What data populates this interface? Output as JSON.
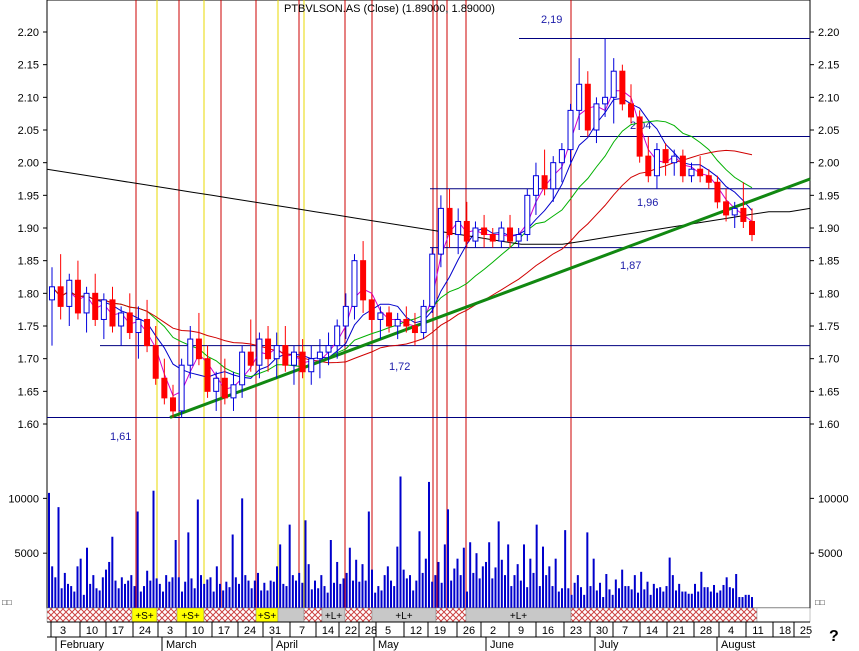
{
  "title": "PTBVLSON.AS (Close) (1.89000, 1.89000)",
  "help_label": "?",
  "colors": {
    "up_candle": "#ffffff",
    "down_candle": "#ff0000",
    "up_candle_blue": "#0000dd",
    "ma_magenta": "#d000d0",
    "ma_blue": "#0000cc",
    "ma_green": "#00b000",
    "ma_red": "#d00000",
    "ma_black": "#000000",
    "trendline": "#118811",
    "support": "#000080",
    "vline_red": "#cc0000",
    "vline_yellow": "#e8d800",
    "volume": "#0000cc",
    "strip_red": "#cc4444",
    "strip_gray": "#c8c8c8",
    "strip_yellow": "#ffff00"
  },
  "chart_data": {
    "type": "candlestick",
    "ylim": [
      1.6,
      2.2
    ],
    "yticks": [
      "2.20",
      "2.15",
      "2.10",
      "2.05",
      "2.00",
      "1.95",
      "1.90",
      "1.85",
      "1.80",
      "1.75",
      "1.70",
      "1.65",
      "1.60"
    ],
    "volume_ticks": [
      "10000",
      "5000"
    ],
    "volume_ylim": [
      0,
      13500
    ],
    "months": [
      "February",
      "March",
      "April",
      "May",
      "June",
      "July",
      "August"
    ],
    "day_ticks": [
      "3",
      "10",
      "17",
      "24",
      "3",
      "10",
      "17",
      "24",
      "31",
      "7",
      "14",
      "22",
      "28",
      "5",
      "12",
      "19",
      "26",
      "2",
      "9",
      "16",
      "23",
      "30",
      "7",
      "14",
      "21",
      "28",
      "4",
      "11",
      "18",
      "25"
    ],
    "levels": [
      {
        "value": 1.61,
        "label": "1,61"
      },
      {
        "value": 1.72,
        "label": "1,72"
      },
      {
        "value": 1.87,
        "label": "1,87"
      },
      {
        "value": 1.96,
        "label": "1,96"
      },
      {
        "value": 2.04,
        "label": "2,04"
      },
      {
        "value": 2.19,
        "label": "2,19"
      }
    ],
    "trendline": {
      "start": 1.61,
      "end": 1.975
    },
    "ma_long": [
      1.99,
      1.985,
      1.98,
      1.975,
      1.97,
      1.965,
      1.96,
      1.955,
      1.95,
      1.945,
      1.94,
      1.935,
      1.93,
      1.925,
      1.92,
      1.915,
      1.91,
      1.905,
      1.9,
      1.895,
      1.89,
      1.885,
      1.88,
      1.875,
      1.875,
      1.875,
      1.88,
      1.885,
      1.89,
      1.895,
      1.9,
      1.905,
      1.91,
      1.915,
      1.92,
      1.925,
      1.925,
      1.93
    ],
    "volumes": [
      10500,
      3800,
      2800,
      9200,
      1800,
      3200,
      2200,
      2000,
      1500,
      3800,
      4500,
      1200,
      5500,
      2200,
      3000,
      1800,
      1600,
      2800,
      3500,
      4200,
      6500,
      2500,
      1800,
      2800,
      2200,
      2500,
      3000,
      2000,
      8800,
      1500,
      2000,
      3400,
      2500,
      10700,
      2700,
      2200,
      1500,
      3000,
      2400,
      2800,
      6200,
      2800,
      1500,
      2400,
      6900,
      2700,
      1800,
      9900,
      3000,
      2200,
      2600,
      2800,
      1500,
      3800,
      2200,
      1600,
      2400,
      1900,
      6700,
      2800,
      2200,
      10000,
      3000,
      2500,
      1800,
      2500,
      3200,
      1600,
      2300,
      1600,
      2500,
      2400,
      3800,
      5800,
      2200,
      2000,
      7600,
      3000,
      2500,
      3200,
      2300,
      8000,
      4000,
      1700,
      2500,
      1800,
      3000,
      2000,
      1400,
      6200,
      2300,
      4200,
      2200,
      2700,
      3200,
      5500,
      2500,
      4400,
      2400,
      4000,
      2500,
      8800,
      3500,
      1400,
      2000,
      1600,
      3000,
      3800,
      2500,
      2000,
      5600,
      12000,
      3500,
      2700,
      3000,
      1600,
      2500,
      7000,
      3200,
      4500,
      11500,
      2400,
      3000,
      4200,
      2300,
      5800,
      9000,
      2500,
      3600,
      4500,
      3000,
      5500,
      1500,
      6000,
      3200,
      5000,
      2700,
      3800,
      4200,
      6000,
      2700,
      3700,
      7900,
      4400,
      3000,
      5800,
      2000,
      3000,
      4000,
      2500,
      5800,
      1900,
      4500,
      3200,
      7600,
      2000,
      5600,
      3000,
      3800,
      2000,
      4500,
      1500,
      1800,
      7100,
      1800,
      1200,
      2300,
      3000,
      1900,
      1200,
      6900,
      2000,
      4500,
      1600,
      2300,
      1000,
      3100,
      1700,
      1200,
      2600,
      1800,
      3500,
      2000,
      2000,
      1700,
      3000,
      1400,
      3300,
      1700,
      2400,
      1200,
      2200,
      1800,
      1900,
      1500,
      2000,
      4600,
      3000,
      1600,
      2200,
      1500,
      1500,
      1300,
      1300,
      2200,
      1500,
      3300,
      1900,
      1900,
      1500,
      2100,
      1400,
      1600,
      2100,
      2800,
      1900,
      1800,
      3100,
      1000,
      1000,
      1200,
      1200,
      1000
    ],
    "candles": [
      [
        1.79,
        1.84,
        1.72,
        1.81
      ],
      [
        1.81,
        1.86,
        1.76,
        1.78
      ],
      [
        1.78,
        1.83,
        1.75,
        1.82
      ],
      [
        1.82,
        1.85,
        1.76,
        1.77
      ],
      [
        1.77,
        1.81,
        1.74,
        1.8
      ],
      [
        1.8,
        1.83,
        1.75,
        1.76
      ],
      [
        1.76,
        1.8,
        1.73,
        1.79
      ],
      [
        1.79,
        1.81,
        1.74,
        1.75
      ],
      [
        1.75,
        1.78,
        1.72,
        1.77
      ],
      [
        1.77,
        1.8,
        1.73,
        1.74
      ],
      [
        1.74,
        1.78,
        1.7,
        1.76
      ],
      [
        1.76,
        1.79,
        1.71,
        1.72
      ],
      [
        1.72,
        1.75,
        1.66,
        1.67
      ],
      [
        1.67,
        1.7,
        1.63,
        1.64
      ],
      [
        1.64,
        1.66,
        1.61,
        1.62
      ],
      [
        1.62,
        1.7,
        1.61,
        1.69
      ],
      [
        1.69,
        1.75,
        1.67,
        1.73
      ],
      [
        1.73,
        1.77,
        1.69,
        1.7
      ],
      [
        1.7,
        1.72,
        1.64,
        1.65
      ],
      [
        1.65,
        1.68,
        1.62,
        1.67
      ],
      [
        1.67,
        1.7,
        1.63,
        1.64
      ],
      [
        1.64,
        1.68,
        1.62,
        1.66
      ],
      [
        1.66,
        1.72,
        1.64,
        1.71
      ],
      [
        1.71,
        1.76,
        1.68,
        1.69
      ],
      [
        1.69,
        1.74,
        1.67,
        1.73
      ],
      [
        1.73,
        1.75,
        1.68,
        1.7
      ],
      [
        1.7,
        1.74,
        1.67,
        1.72
      ],
      [
        1.72,
        1.75,
        1.68,
        1.69
      ],
      [
        1.69,
        1.72,
        1.66,
        1.71
      ],
      [
        1.71,
        1.73,
        1.67,
        1.68
      ],
      [
        1.68,
        1.72,
        1.66,
        1.7
      ],
      [
        1.7,
        1.73,
        1.67,
        1.71
      ],
      [
        1.71,
        1.74,
        1.69,
        1.72
      ],
      [
        1.72,
        1.76,
        1.7,
        1.75
      ],
      [
        1.75,
        1.8,
        1.73,
        1.78
      ],
      [
        1.78,
        1.86,
        1.76,
        1.85
      ],
      [
        1.85,
        1.88,
        1.77,
        1.79
      ],
      [
        1.79,
        1.8,
        1.74,
        1.76
      ],
      [
        1.76,
        1.78,
        1.73,
        1.77
      ],
      [
        1.77,
        1.78,
        1.74,
        1.75
      ],
      [
        1.75,
        1.77,
        1.73,
        1.76
      ],
      [
        1.76,
        1.78,
        1.74,
        1.75
      ],
      [
        1.75,
        1.77,
        1.72,
        1.74
      ],
      [
        1.74,
        1.79,
        1.73,
        1.78
      ],
      [
        1.78,
        1.87,
        1.77,
        1.86
      ],
      [
        1.86,
        1.95,
        1.84,
        1.93
      ],
      [
        1.93,
        1.96,
        1.87,
        1.89
      ],
      [
        1.89,
        1.93,
        1.86,
        1.91
      ],
      [
        1.91,
        1.94,
        1.87,
        1.88
      ],
      [
        1.88,
        1.91,
        1.87,
        1.9
      ],
      [
        1.9,
        1.92,
        1.87,
        1.89
      ],
      [
        1.89,
        1.9,
        1.87,
        1.88
      ],
      [
        1.88,
        1.91,
        1.87,
        1.9
      ],
      [
        1.9,
        1.92,
        1.87,
        1.88
      ],
      [
        1.88,
        1.9,
        1.87,
        1.89
      ],
      [
        1.89,
        1.96,
        1.88,
        1.95
      ],
      [
        1.95,
        2.0,
        1.92,
        1.98
      ],
      [
        1.98,
        2.02,
        1.95,
        1.96
      ],
      [
        1.96,
        2.01,
        1.94,
        2.0
      ],
      [
        2.0,
        2.03,
        1.97,
        2.02
      ],
      [
        2.02,
        2.09,
        2.0,
        2.08
      ],
      [
        2.08,
        2.16,
        2.05,
        2.12
      ],
      [
        2.12,
        2.14,
        2.04,
        2.05
      ],
      [
        2.05,
        2.1,
        2.03,
        2.09
      ],
      [
        2.09,
        2.19,
        2.07,
        2.1
      ],
      [
        2.1,
        2.16,
        2.06,
        2.14
      ],
      [
        2.14,
        2.15,
        2.08,
        2.09
      ],
      [
        2.09,
        2.12,
        2.06,
        2.07
      ],
      [
        2.07,
        2.08,
        2.0,
        2.01
      ],
      [
        2.01,
        2.04,
        1.97,
        1.98
      ],
      [
        1.98,
        2.03,
        1.96,
        2.02
      ],
      [
        2.02,
        2.03,
        1.98,
        2.0
      ],
      [
        2.0,
        2.02,
        1.98,
        2.01
      ],
      [
        2.01,
        2.02,
        1.97,
        1.98
      ],
      [
        1.98,
        2.0,
        1.97,
        1.99
      ],
      [
        1.99,
        2.01,
        1.97,
        1.98
      ],
      [
        1.98,
        1.99,
        1.96,
        1.97
      ],
      [
        1.97,
        1.98,
        1.93,
        1.94
      ],
      [
        1.94,
        1.96,
        1.91,
        1.92
      ],
      [
        1.92,
        1.94,
        1.9,
        1.93
      ],
      [
        1.93,
        1.97,
        1.9,
        1.91
      ],
      [
        1.91,
        1.93,
        1.88,
        1.89
      ]
    ],
    "highlight": [
      {
        "type": "red"
      },
      {
        "type": "yellow"
      },
      {
        "type": "red"
      },
      {
        "type": "yellow"
      },
      {
        "type": "red"
      },
      {
        "type": "red"
      },
      {
        "type": "yellow"
      },
      {
        "type": "red"
      },
      {
        "type": "yellow"
      },
      {
        "type": "red"
      },
      {
        "type": "red"
      },
      {
        "type": "red"
      },
      {
        "type": "red"
      },
      {
        "type": "red"
      },
      {
        "type": "red"
      },
      {
        "type": "red"
      }
    ],
    "signal_strip": [
      {
        "type": "red",
        "label": ""
      },
      {
        "type": "yellow",
        "label": "+S+"
      },
      {
        "type": "red",
        "label": ""
      },
      {
        "type": "yellow",
        "label": "+S+"
      },
      {
        "type": "red",
        "label": ""
      },
      {
        "type": "yellow",
        "label": "+S+"
      },
      {
        "type": "gray",
        "label": ""
      },
      {
        "type": "red",
        "label": ""
      },
      {
        "type": "gray",
        "label": "+L+"
      },
      {
        "type": "red",
        "label": ""
      },
      {
        "type": "gray",
        "label": "+L+"
      },
      {
        "type": "red",
        "label": ""
      },
      {
        "type": "gray",
        "label": "+L+"
      },
      {
        "type": "red",
        "label": ""
      }
    ]
  }
}
